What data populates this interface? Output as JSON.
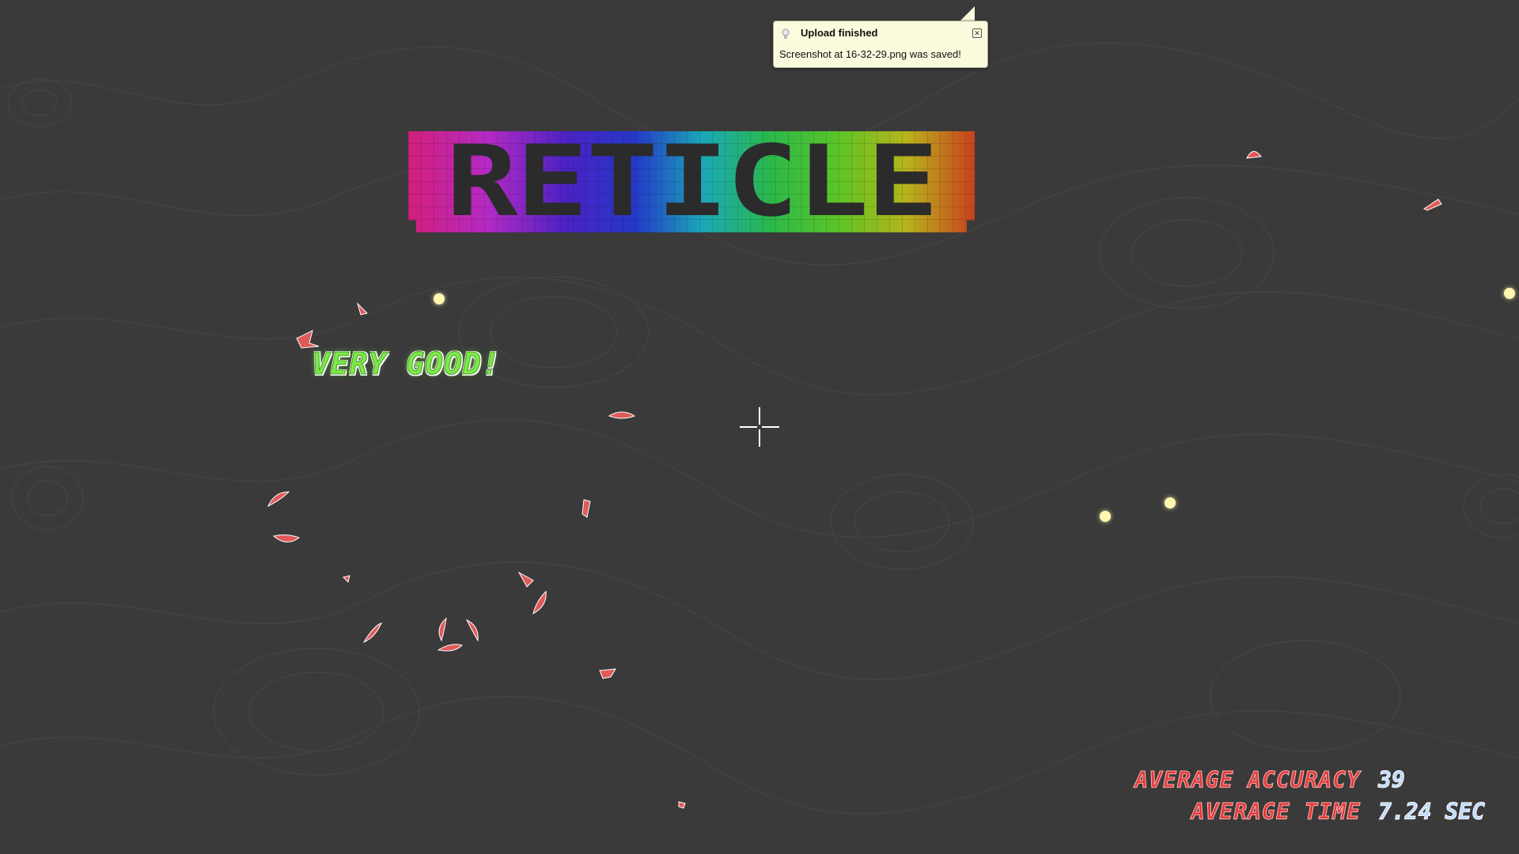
{
  "game": {
    "title": "RETICLE",
    "praise": "VERY GOOD!"
  },
  "stats": {
    "accuracy_label": "AVERAGE ACCURACY",
    "accuracy_value": "39",
    "time_label": "AVERAGE TIME",
    "time_value": "7.24 SEC"
  },
  "notification": {
    "title": "Upload finished",
    "message": "Screenshot at 16-32-29.png was saved!",
    "close_icon": "close-icon",
    "status_icon": "lightbulb-icon"
  },
  "colors": {
    "background": "#3a3a3a",
    "praise": "#7ee84a",
    "stat_label": "#e03a3a",
    "stat_value": "#b8d8ff",
    "shard": "#e05a5a",
    "particle": "#fff7b0"
  }
}
